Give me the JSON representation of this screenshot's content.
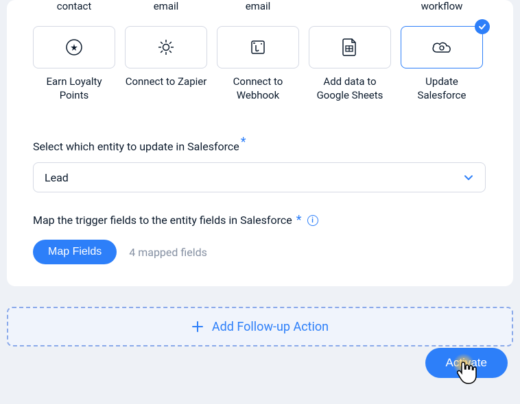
{
  "top_row_labels": [
    "contact",
    "email",
    "email",
    "",
    "workflow"
  ],
  "options": [
    {
      "label": "Earn Loyalty Points",
      "icon": "star-circle"
    },
    {
      "label": "Connect to Zapier",
      "icon": "gear"
    },
    {
      "label": "Connect to Webhook",
      "icon": "webhook"
    },
    {
      "label": "Add data to Google Sheets",
      "icon": "sheet"
    },
    {
      "label": "Update Salesforce",
      "icon": "cloud-refresh",
      "selected": true
    }
  ],
  "entity": {
    "label": "Select which entity to update in Salesforce",
    "value": "Lead"
  },
  "mapping": {
    "label": "Map the trigger fields to the entity fields in Salesforce",
    "button": "Map Fields",
    "count_text": "4 mapped fields"
  },
  "followup": {
    "label": "Add Follow-up Action"
  },
  "activate": {
    "label": "Activate"
  }
}
